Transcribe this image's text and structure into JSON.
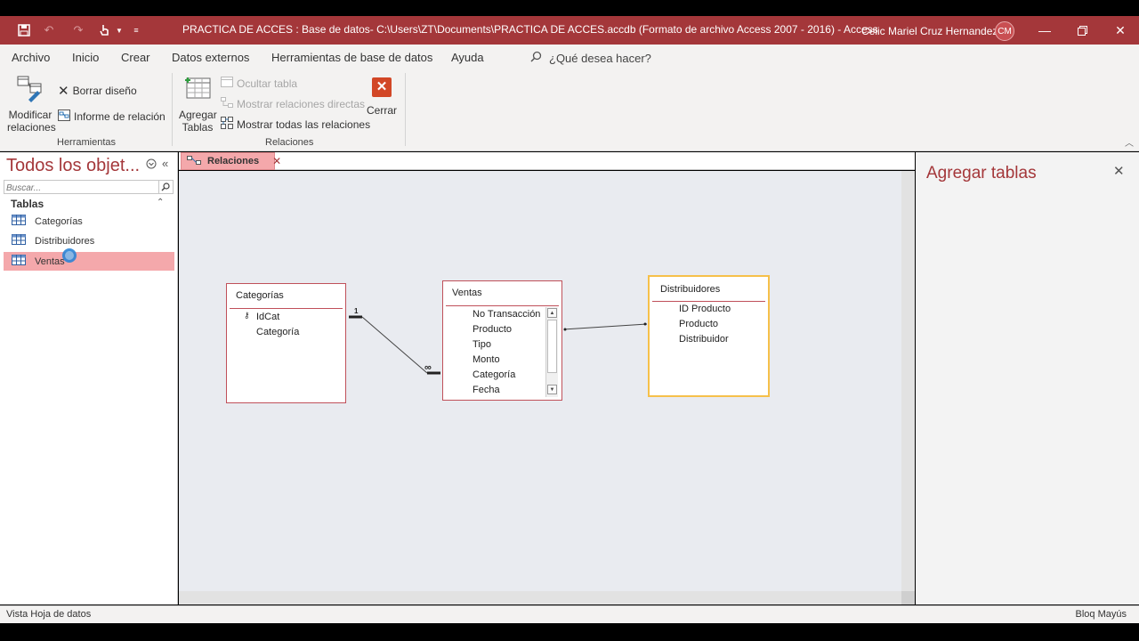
{
  "window": {
    "title": "PRACTICA DE ACCES : Base de datos- C:\\Users\\ZT\\Documents\\PRACTICA DE ACCES.accdb (Formato de archivo Access 2007 - 2016)  -  Access",
    "user_name": "Celic Mariel Cruz Hernandez",
    "user_initials": "CM"
  },
  "menu": {
    "archivo": "Archivo",
    "inicio": "Inicio",
    "crear": "Crear",
    "datos_externos": "Datos externos",
    "herramientas_bd": "Herramientas de base de datos",
    "ayuda": "Ayuda",
    "tell_me": "¿Qué desea hacer?"
  },
  "ribbon": {
    "modificar_relaciones": [
      "Modificar",
      "relaciones"
    ],
    "borrar_diseno": "Borrar diseño",
    "informe_relacion": "Informe de relación",
    "group_herramientas": "Herramientas",
    "agregar_tablas": [
      "Agregar",
      "Tablas"
    ],
    "ocultar_tabla": "Ocultar tabla",
    "mostrar_directas": "Mostrar relaciones directas",
    "mostrar_todas": "Mostrar todas las relaciones",
    "cerrar": "Cerrar",
    "group_relaciones": "Relaciones"
  },
  "nav": {
    "title": "Todos los objet...",
    "search_placeholder": "Buscar...",
    "group": "Tablas",
    "items": [
      {
        "label": "Categorías",
        "selected": false
      },
      {
        "label": "Distribuidores",
        "selected": false
      },
      {
        "label": "Ventas",
        "selected": true
      }
    ]
  },
  "doc_tab": {
    "label": "Relaciones"
  },
  "tables": {
    "categorias": {
      "name": "Categorías",
      "fields": [
        "IdCat",
        "Categoría"
      ]
    },
    "ventas": {
      "name": "Ventas",
      "fields": [
        "No Transacción",
        "Producto",
        "Tipo",
        "Monto",
        "Categoría",
        "Fecha"
      ]
    },
    "distribuidores": {
      "name": "Distribuidores",
      "fields": [
        "ID Producto",
        "Producto",
        "Distribuidor"
      ]
    }
  },
  "relationship": {
    "one_symbol": "1",
    "many_symbol": "∞"
  },
  "pane": {
    "title": "Agregar tablas"
  },
  "status": {
    "left": "Vista Hoja de datos",
    "right": "Bloq Mayús"
  },
  "colors": {
    "accent": "#a4373a",
    "selection": "#f4a8ab",
    "table_border": "#c0505a",
    "selected_table_border": "#f6c04a"
  }
}
